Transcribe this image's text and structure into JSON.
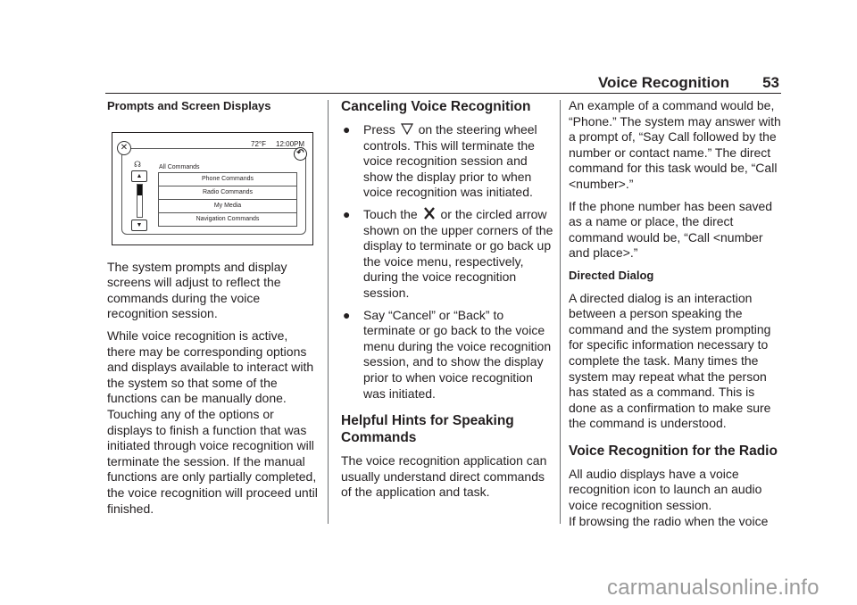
{
  "header": {
    "section_title": "Voice Recognition",
    "page_number": "53"
  },
  "column1": {
    "subhead": "Prompts and Screen Displays",
    "figure": {
      "temperature": "72°F",
      "time": "12:00PM",
      "close_icon": "circled-x-icon",
      "back_icon": "circled-back-arrow-icon",
      "voice_icon": "voice-recognition-icon",
      "menu_title": "All Commands",
      "scroll_up_icon": "triangle-up-icon",
      "scroll_down_icon": "triangle-down-icon",
      "items": [
        "Phone Commands",
        "Radio Commands",
        "My Media",
        "Navigation Commands"
      ]
    },
    "paragraphs": [
      "The system prompts and display screens will adjust to reflect the commands during the voice recognition session.",
      "While voice recognition is active, there may be corresponding options and displays available to interact with the system so that some of the functions can be manually done. Touching any of the options or displays to finish a function that was initiated through voice recognition will terminate the session. If the manual functions are only partially completed, the voice recognition will proceed until finished."
    ]
  },
  "column2": {
    "heading1": "Canceling Voice Recognition",
    "bullets": [
      {
        "marker": "●",
        "pre": "Press",
        "icon": "end-voice-triangle-icon",
        "post": "on the steering wheel controls. This will terminate the voice recognition session and show the display prior to when voice recognition was initiated."
      },
      {
        "marker": "●",
        "pre": "Touch the",
        "icon": "x-close-icon",
        "post": "or the circled arrow shown on the upper corners of the display to terminate or go back up the voice menu, respectively, during the voice recognition session."
      },
      {
        "marker": "●",
        "pre": "",
        "icon": "",
        "post": "Say “Cancel” or “Back” to terminate or go back to the voice menu during the voice recognition session, and to show the display prior to when voice recognition was initiated."
      }
    ],
    "heading2": "Helpful Hints for Speaking Commands",
    "paragraph": "The voice recognition application can usually understand direct commands of the application and task."
  },
  "column3": {
    "paragraphs": [
      "An example of a command would be, “Phone.” The system may answer with a prompt of, “Say Call followed by the number or contact name.” The direct command for this task would be, “Call <number>.”",
      "If the phone number has been saved as a name or place, the direct command would be, “Call <number and place>.”"
    ],
    "subhead": "Directed Dialog",
    "dialog_paragraph": "A directed dialog is an interaction between a person speaking the command and the system prompting for specific information necessary to complete the task. Many times the system may repeat what the person has stated as a command. This is done as a confirmation to make sure the command is understood.",
    "heading": "Voice Recognition for the Radio",
    "radio_paragraph_lines": [
      "All audio displays have a voice recognition icon to launch an audio voice recognition session.",
      "If browsing the radio when the voice"
    ]
  },
  "watermark": "carmanualsonline.info"
}
